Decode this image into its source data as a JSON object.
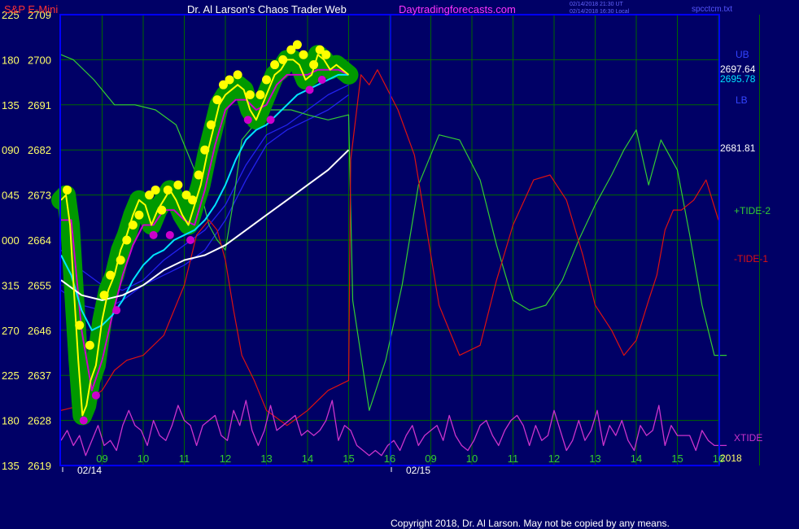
{
  "header": {
    "symbol": "S&P E-Mini",
    "title": "Dr. Al Larson's Chaos Trader Web",
    "site": "Daytradingforecasts.com",
    "stamp1": "02/14/2018 21:30 UT",
    "stamp2": "02/14/2018 16:30 Local",
    "file": "spcctcm.txt"
  },
  "footer": {
    "copyright": "Copyright 2018, Dr. Al Larson. May not be copied by any means."
  },
  "right_labels": {
    "ub": "UB",
    "lb": "LB",
    "price1": "2697.64",
    "price2": "2695.78",
    "price3": "2681.81",
    "tide2": "+TIDE-2",
    "tide1": "-TIDE-1",
    "xtide": "XTIDE"
  },
  "colors": {
    "background": "#000066",
    "plot_border": "#0000ff",
    "grid": "#006600",
    "price": "#ffff00",
    "halo": "#009900",
    "ma_fast": "#cc00cc",
    "ma_cyan": "#00e5ff",
    "ma_white": "#ffffff",
    "band": "#2222ee",
    "tide_green": "#33cc33",
    "tide_red": "#dd1111",
    "xtide": "#cc33cc"
  },
  "chart_data": {
    "type": "line",
    "y_axis": {
      "price_ticks": [
        2709,
        2700,
        2691,
        2682,
        2673,
        2664,
        2655,
        2646,
        2637,
        2628,
        2619
      ],
      "angle_ticks": [
        "225",
        "180",
        "135",
        "090",
        "045",
        "000",
        "315",
        "270",
        "225",
        "180",
        "135"
      ],
      "ylim": [
        2619,
        2709
      ]
    },
    "x_axis": {
      "hour_labels": [
        "09",
        "10",
        "11",
        "12",
        "13",
        "14",
        "15",
        "16",
        "09",
        "10",
        "11",
        "12",
        "13",
        "14",
        "15",
        "16"
      ],
      "date_labels": [
        "02/14",
        "02/15"
      ],
      "year_label": "2018",
      "ticks_per_day": 9,
      "days": 2
    },
    "series": [
      {
        "name": "Price",
        "role": "price",
        "x": [
          0.0,
          0.12,
          0.22,
          0.32,
          0.42,
          0.52,
          0.62,
          0.72,
          0.85,
          1.0,
          1.15,
          1.3,
          1.45,
          1.6,
          1.75,
          1.9,
          2.05,
          2.2,
          2.35,
          2.5,
          2.65,
          2.8,
          2.95,
          3.1,
          3.25,
          3.4,
          3.55,
          3.7,
          3.85,
          4.0,
          4.15,
          4.3,
          4.45,
          4.6,
          4.75,
          4.9,
          5.05,
          5.2,
          5.35,
          5.5,
          5.65,
          5.8,
          5.95,
          6.1,
          6.25,
          6.4,
          6.55,
          6.7,
          6.85,
          7.0
        ],
        "values": [
          2672,
          2673,
          2667,
          2653,
          2640,
          2629,
          2631,
          2636,
          2639,
          2648,
          2654,
          2657,
          2662,
          2665,
          2669,
          2672,
          2671,
          2667,
          2670,
          2672,
          2674,
          2672,
          2669,
          2667,
          2671,
          2675,
          2681,
          2686,
          2691,
          2693,
          2694,
          2695,
          2694,
          2690,
          2688,
          2691,
          2694,
          2697,
          2698,
          2700,
          2700,
          2699,
          2696,
          2697,
          2701,
          2700,
          2698,
          2699,
          2698,
          2697
        ]
      },
      {
        "name": "Fast MA",
        "role": "ma_fast",
        "x": [
          0.0,
          0.25,
          0.5,
          0.75,
          1.0,
          1.25,
          1.5,
          1.75,
          2.0,
          2.25,
          2.5,
          2.75,
          3.0,
          3.25,
          3.5,
          3.75,
          4.0,
          4.25,
          4.5,
          4.75,
          5.0,
          5.25,
          5.5,
          5.75,
          6.0,
          6.25,
          6.5,
          6.75,
          7.0
        ],
        "values": [
          2668,
          2668,
          2646,
          2634,
          2640,
          2649,
          2657,
          2663,
          2667,
          2667,
          2670,
          2670,
          2668,
          2667,
          2674,
          2683,
          2690,
          2692,
          2692,
          2690,
          2691,
          2695,
          2697,
          2697,
          2697,
          2698,
          2698,
          2698,
          2697
        ]
      },
      {
        "name": "Cyan MA",
        "role": "ma_cyan",
        "x": [
          0.0,
          0.25,
          0.5,
          0.75,
          1.0,
          1.25,
          1.5,
          1.75,
          2.0,
          2.25,
          2.5,
          2.75,
          3.0,
          3.25,
          3.5,
          3.75,
          4.0,
          4.25,
          4.5,
          4.75,
          5.0,
          5.25,
          5.5,
          5.75,
          6.0,
          6.25,
          6.5,
          6.75,
          7.0
        ],
        "values": [
          2661,
          2657,
          2650,
          2646,
          2647,
          2649,
          2652,
          2656,
          2659,
          2661,
          2662,
          2664,
          2665,
          2666,
          2668,
          2671,
          2675,
          2680,
          2684,
          2686,
          2687,
          2689,
          2691,
          2693,
          2694,
          2695,
          2696,
          2697,
          2697
        ]
      },
      {
        "name": "Upper band",
        "role": "band",
        "x": [
          0.0,
          0.5,
          1.0,
          1.5,
          2.0,
          2.5,
          3.0,
          3.5,
          4.0,
          4.5,
          5.0,
          5.5,
          6.0,
          6.5,
          7.0
        ],
        "values": [
          2654,
          2651,
          2650,
          2652,
          2655,
          2657,
          2659,
          2662,
          2668,
          2676,
          2683,
          2686,
          2688,
          2690,
          2693
        ]
      },
      {
        "name": "Lower band",
        "role": "band",
        "x": [
          0.0,
          0.5,
          1.0,
          1.5,
          2.0,
          2.5,
          3.0,
          3.5,
          4.0,
          4.5,
          5.0,
          5.5,
          6.0,
          6.5,
          7.0
        ],
        "values": [
          2662,
          2658,
          2655,
          2654,
          2656,
          2660,
          2663,
          2666,
          2671,
          2679,
          2685,
          2687,
          2690,
          2693,
          2695
        ]
      },
      {
        "name": "Slow MA",
        "role": "ma_white",
        "x": [
          0.0,
          0.5,
          1.0,
          1.5,
          2.0,
          2.5,
          3.0,
          3.5,
          4.0,
          4.5,
          5.0,
          5.5,
          6.0,
          6.5,
          7.0
        ],
        "values": [
          2656,
          2653,
          2652,
          2653,
          2655,
          2658,
          2660,
          2661,
          2663,
          2666,
          2669,
          2672,
          2675,
          2678,
          2682
        ]
      },
      {
        "name": "+TIDE-2",
        "role": "tide_green",
        "x": [
          0.0,
          0.3,
          0.8,
          1.3,
          1.8,
          2.3,
          2.8,
          3.3,
          3.6,
          3.8,
          4.0,
          4.2,
          4.4,
          4.7,
          5.0,
          5.3,
          5.6,
          6.0,
          6.5,
          7.0,
          7.1,
          7.5,
          7.9,
          8.3,
          8.7,
          9.2,
          9.7,
          10.2,
          10.6,
          11.0,
          11.4,
          11.8,
          12.2,
          12.6,
          13.0,
          13.4,
          13.7,
          14.0,
          14.3,
          14.6,
          15.0,
          15.3,
          15.6,
          15.9,
          16.0,
          16.2
        ],
        "values": [
          2701,
          2700,
          2696,
          2691,
          2691,
          2690,
          2687,
          2677,
          2667,
          2664,
          2662,
          2672,
          2684,
          2687,
          2690,
          2690,
          2690,
          2689,
          2688,
          2689,
          2652,
          2630,
          2640,
          2655,
          2675,
          2685,
          2684,
          2676,
          2663,
          2652,
          2650,
          2651,
          2656,
          2664,
          2671,
          2677,
          2682,
          2686,
          2675,
          2684,
          2678,
          2665,
          2651,
          2641,
          2641,
          2641
        ]
      },
      {
        "name": "-TIDE-1",
        "role": "tide_red",
        "x": [
          0.0,
          0.5,
          1.0,
          1.3,
          1.6,
          2.0,
          2.5,
          3.0,
          3.3,
          3.6,
          3.8,
          4.0,
          4.2,
          4.4,
          4.7,
          5.0,
          5.5,
          6.0,
          6.5,
          7.0,
          7.05,
          7.3,
          7.5,
          7.7,
          8.2,
          8.6,
          8.9,
          9.2,
          9.7,
          10.2,
          10.6,
          11.0,
          11.5,
          11.9,
          12.3,
          12.7,
          13.0,
          13.4,
          13.7,
          14.0,
          14.3,
          14.5,
          14.7,
          14.9,
          15.1,
          15.4,
          15.7,
          16.0
        ],
        "values": [
          2630,
          2631,
          2634,
          2638,
          2640,
          2641,
          2645,
          2655,
          2665,
          2668,
          2666,
          2660,
          2650,
          2641,
          2636,
          2630,
          2627,
          2630,
          2634,
          2636,
          2680,
          2697,
          2695,
          2698,
          2690,
          2681,
          2666,
          2651,
          2641,
          2643,
          2656,
          2667,
          2676,
          2677,
          2672,
          2661,
          2651,
          2646,
          2641,
          2644,
          2652,
          2657,
          2666,
          2670,
          2670,
          2672,
          2676,
          2668
        ]
      },
      {
        "name": "XTIDE",
        "role": "xtide",
        "x": [
          0.0,
          0.15,
          0.3,
          0.45,
          0.6,
          0.75,
          0.9,
          1.05,
          1.2,
          1.35,
          1.5,
          1.65,
          1.8,
          1.95,
          2.1,
          2.25,
          2.4,
          2.55,
          2.7,
          2.85,
          3.0,
          3.15,
          3.3,
          3.45,
          3.6,
          3.75,
          3.9,
          4.05,
          4.2,
          4.35,
          4.5,
          4.65,
          4.8,
          4.95,
          5.1,
          5.25,
          5.4,
          5.55,
          5.7,
          5.85,
          6.0,
          6.15,
          6.3,
          6.45,
          6.6,
          6.75,
          6.9,
          7.05,
          7.2,
          7.35,
          7.5,
          7.65,
          7.8,
          7.95,
          8.1,
          8.25,
          8.4,
          8.55,
          8.7,
          8.85,
          9.0,
          9.15,
          9.3,
          9.45,
          9.6,
          9.75,
          9.9,
          10.05,
          10.2,
          10.35,
          10.5,
          10.65,
          10.8,
          10.95,
          11.1,
          11.25,
          11.4,
          11.55,
          11.7,
          11.85,
          12.0,
          12.15,
          12.3,
          12.45,
          12.6,
          12.75,
          12.9,
          13.05,
          13.2,
          13.35,
          13.5,
          13.65,
          13.8,
          13.95,
          14.1,
          14.25,
          14.4,
          14.55,
          14.7,
          14.85,
          15.0,
          15.15,
          15.3,
          15.45,
          15.6,
          15.75,
          15.9,
          16.05,
          16.2
        ],
        "values": [
          2624,
          2626,
          2623,
          2625,
          2621,
          2624,
          2627,
          2623,
          2624,
          2622,
          2627,
          2630,
          2627,
          2626,
          2623,
          2628,
          2625,
          2624,
          2627,
          2631,
          2628,
          2627,
          2623,
          2627,
          2628,
          2629,
          2625,
          2624,
          2630,
          2627,
          2632,
          2626,
          2623,
          2626,
          2631,
          2626,
          2627,
          2628,
          2629,
          2625,
          2626,
          2625,
          2626,
          2628,
          2632,
          2624,
          2627,
          2626,
          2623,
          2622,
          2621,
          2622,
          2621,
          2623,
          2624,
          2622,
          2625,
          2627,
          2623,
          2625,
          2626,
          2627,
          2624,
          2629,
          2625,
          2623,
          2622,
          2624,
          2627,
          2628,
          2625,
          2623,
          2626,
          2628,
          2629,
          2627,
          2623,
          2627,
          2624,
          2625,
          2630,
          2626,
          2622,
          2624,
          2628,
          2624,
          2626,
          2630,
          2623,
          2627,
          2625,
          2628,
          2624,
          2622,
          2627,
          2625,
          2626,
          2631,
          2623,
          2627,
          2625,
          2625,
          2625,
          2622,
          2626,
          2624,
          2623,
          2623,
          2623
        ]
      }
    ],
    "markers": {
      "yellow_highs_x": [
        0.15,
        0.45,
        0.7,
        1.05,
        1.2,
        1.45,
        1.6,
        1.75,
        1.9,
        2.15,
        2.3,
        2.45,
        2.6,
        2.85,
        3.05,
        3.2,
        3.35,
        3.5,
        3.65,
        3.8,
        3.95,
        4.1,
        4.3,
        4.6,
        4.85,
        5.0,
        5.2,
        5.4,
        5.6,
        5.75,
        5.9,
        6.15,
        6.3,
        6.45
      ],
      "yellow_highs_y": [
        2674,
        2647,
        2643,
        2653,
        2657,
        2660,
        2664,
        2667,
        2669,
        2673,
        2674,
        2670,
        2674,
        2675,
        2673,
        2672,
        2677,
        2682,
        2687,
        2692,
        2695,
        2696,
        2697,
        2693,
        2693,
        2696,
        2699,
        2700,
        2702,
        2703,
        2701,
        2699,
        2702,
        2701
      ],
      "magenta_lows_x": [
        0.55,
        0.85,
        1.35,
        2.25,
        2.65,
        3.15,
        4.55,
        5.1,
        6.05,
        6.35
      ],
      "magenta_lows_y": [
        2628,
        2633,
        2650,
        2665,
        2665,
        2664,
        2688,
        2688,
        2694,
        2696
      ]
    }
  }
}
